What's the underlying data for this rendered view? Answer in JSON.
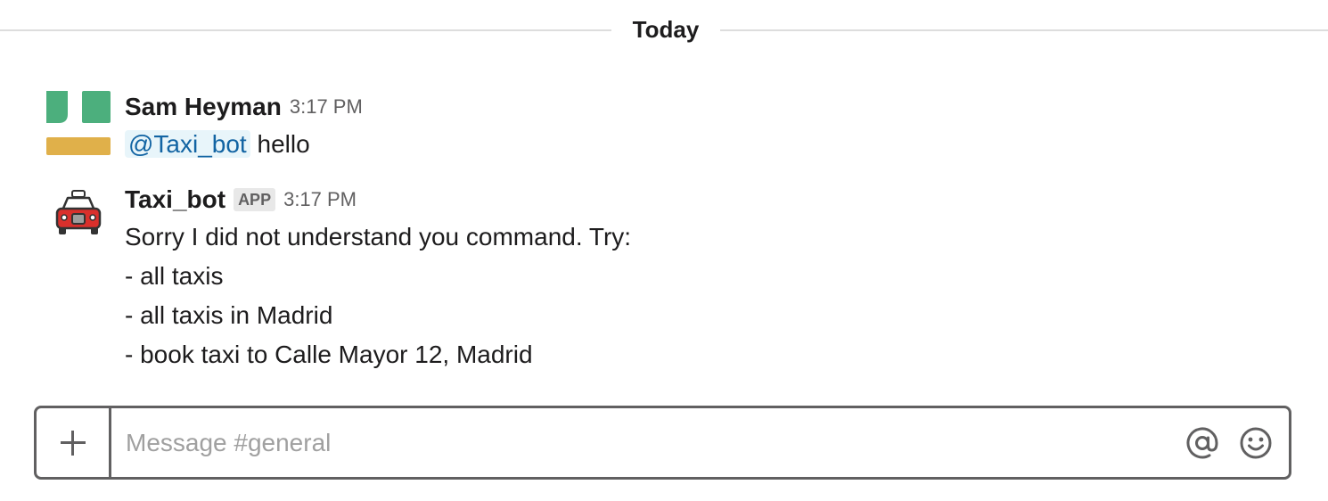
{
  "divider": {
    "label": "Today"
  },
  "messages": [
    {
      "sender": "Sam Heyman",
      "time": "3:17 PM",
      "mention": "@Taxi_bot",
      "text": "hello",
      "avatar_icon": "green-yellow-blocks-avatar",
      "avatar_colors": {
        "green": "#4caf7d",
        "gold": "#e0b04a"
      }
    },
    {
      "sender": "Taxi_bot",
      "badge": "APP",
      "time": "3:17 PM",
      "avatar_icon": "taxi-icon",
      "lines": [
        "Sorry I did not understand you command. Try:",
        "- all taxis",
        "- all taxis in Madrid",
        "- book taxi to Calle Mayor 12, Madrid"
      ]
    }
  ],
  "composer": {
    "placeholder": "Message #general",
    "value": "",
    "add_icon": "plus-icon",
    "mention_icon": "at-icon",
    "emoji_icon": "smiley-icon"
  },
  "colors": {
    "mention_text": "#1264a3",
    "mention_bg": "#e8f5fa",
    "taxi_red": "#d9302c"
  }
}
